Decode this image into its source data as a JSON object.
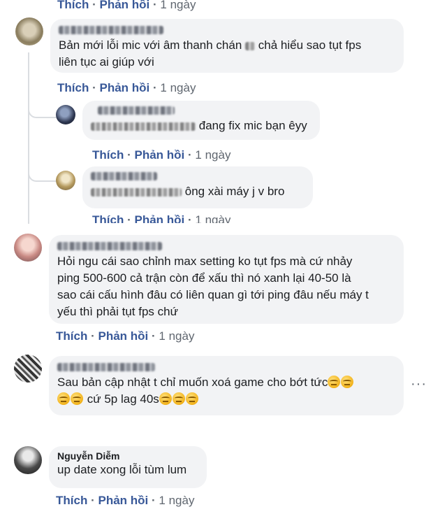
{
  "actions": {
    "like": "Thích",
    "reply": "Phản hồi",
    "sep": "·",
    "time": "1 ngày"
  },
  "comments": [
    {
      "name": "",
      "name_visible": "",
      "lines": [
        "Bản mới lỗi mic với âm thanh chán",
        "chả hiểu sao tụt fps",
        "liên tục ai giúp với"
      ]
    },
    {
      "name": "",
      "lines": [
        "đang fix mic bạn êyy"
      ]
    },
    {
      "name": "",
      "lines": [
        "ông xài máy j v bro"
      ]
    },
    {
      "name": "",
      "lines": [
        "Hỏi ngu cái sao chỉnh max setting ko tụt fps mà cứ nhảy",
        "ping 500-600 cả trận còn để xấu thì nó xanh lại 40-50 là",
        "sao cái cấu hình đâu có liên quan gì tới ping đâu nếu máy t",
        "yếu thì phải tụt fps chứ"
      ]
    },
    {
      "name": "",
      "lines": [
        "Sau bản cập nhật t chỉ muốn xoá game cho bớt tức",
        "cứ 5p lag 40s"
      ]
    },
    {
      "name": "Nguyễn Diễm",
      "lines": [
        "up date xong lỗi tùm lum"
      ]
    }
  ],
  "more_label": "···",
  "colors": {
    "link": "#385898",
    "bubble": "#f2f3f5",
    "meta": "#606770"
  }
}
